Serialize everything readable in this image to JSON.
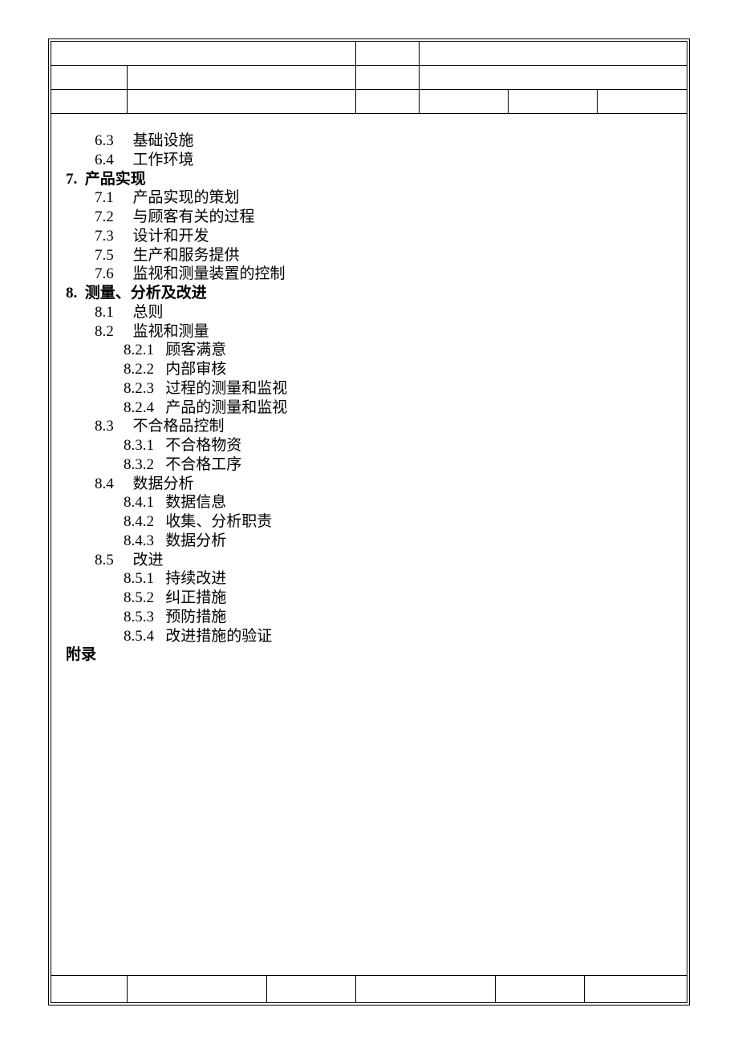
{
  "toc": [
    {
      "level": 1,
      "num": "6.3",
      "title": "基础设施",
      "bold": false
    },
    {
      "level": 1,
      "num": "6.4",
      "title": "工作环境",
      "bold": false
    },
    {
      "level": 0,
      "num": "7.",
      "title": "产品实现",
      "bold": true
    },
    {
      "level": 1,
      "num": "7.1",
      "title": "产品实现的策划",
      "bold": false
    },
    {
      "level": 1,
      "num": "7.2",
      "title": "与顾客有关的过程",
      "bold": false
    },
    {
      "level": 1,
      "num": "7.3",
      "title": "设计和开发",
      "bold": false
    },
    {
      "level": 1,
      "num": "7.5",
      "title": "生产和服务提供",
      "bold": false
    },
    {
      "level": 1,
      "num": "7.6",
      "title": "监视和测量装置的控制",
      "bold": false
    },
    {
      "level": 0,
      "num": "8.",
      "title": "测量、分析及改进",
      "bold": true
    },
    {
      "level": 1,
      "num": "8.1",
      "title": "总则",
      "bold": false
    },
    {
      "level": 1,
      "num": "8.2",
      "title": "监视和测量",
      "bold": false
    },
    {
      "level": 2,
      "num": "8.2.1",
      "title": "顾客满意",
      "bold": false
    },
    {
      "level": 2,
      "num": "8.2.2",
      "title": "内部审核",
      "bold": false
    },
    {
      "level": 2,
      "num": "8.2.3",
      "title": "过程的测量和监视",
      "bold": false
    },
    {
      "level": 2,
      "num": "8.2.4",
      "title": "产品的测量和监视",
      "bold": false
    },
    {
      "level": 1,
      "num": "8.3",
      "title": "不合格品控制",
      "bold": false
    },
    {
      "level": 2,
      "num": "8.3.1",
      "title": "不合格物资",
      "bold": false
    },
    {
      "level": 2,
      "num": "8.3.2",
      "title": "不合格工序",
      "bold": false
    },
    {
      "level": 1,
      "num": "8.4",
      "title": "数据分析",
      "bold": false
    },
    {
      "level": 2,
      "num": "8.4.1",
      "title": "数据信息",
      "bold": false
    },
    {
      "level": 2,
      "num": "8.4.2",
      "title": "收集、分析职责",
      "bold": false
    },
    {
      "level": 2,
      "num": "8.4.3",
      "title": "数据分析",
      "bold": false
    },
    {
      "level": 1,
      "num": "8.5",
      "title": "改进",
      "bold": false
    },
    {
      "level": 2,
      "num": "8.5.1",
      "title": "持续改进",
      "bold": false
    },
    {
      "level": 2,
      "num": "8.5.2",
      "title": "纠正措施",
      "bold": false
    },
    {
      "level": 2,
      "num": "8.5.3",
      "title": "预防措施",
      "bold": false
    },
    {
      "level": 2,
      "num": "8.5.4",
      "title": "改进措施的验证",
      "bold": false
    },
    {
      "level": 0,
      "num": "",
      "title": "附录",
      "bold": true
    }
  ]
}
